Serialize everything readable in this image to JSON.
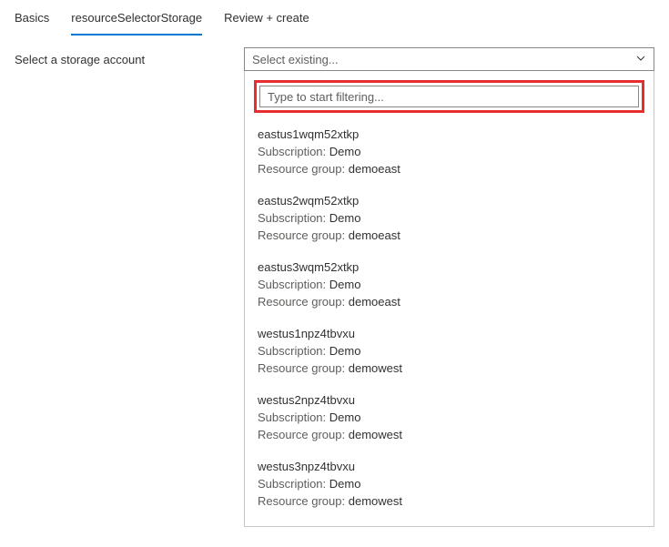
{
  "tabs": [
    {
      "label": "Basics",
      "active": false
    },
    {
      "label": "resourceSelectorStorage",
      "active": true
    },
    {
      "label": "Review + create",
      "active": false
    }
  ],
  "form": {
    "label": "Select a storage account",
    "dropdown_placeholder": "Select existing...",
    "filter_placeholder": "Type to start filtering...",
    "sub_key": "Subscription:",
    "rg_key": "Resource group:",
    "options": [
      {
        "name": "eastus1wqm52xtkp",
        "subscription": "Demo",
        "resource_group": "demoeast"
      },
      {
        "name": "eastus2wqm52xtkp",
        "subscription": "Demo",
        "resource_group": "demoeast"
      },
      {
        "name": "eastus3wqm52xtkp",
        "subscription": "Demo",
        "resource_group": "demoeast"
      },
      {
        "name": "westus1npz4tbvxu",
        "subscription": "Demo",
        "resource_group": "demowest"
      },
      {
        "name": "westus2npz4tbvxu",
        "subscription": "Demo",
        "resource_group": "demowest"
      },
      {
        "name": "westus3npz4tbvxu",
        "subscription": "Demo",
        "resource_group": "demowest"
      }
    ]
  }
}
